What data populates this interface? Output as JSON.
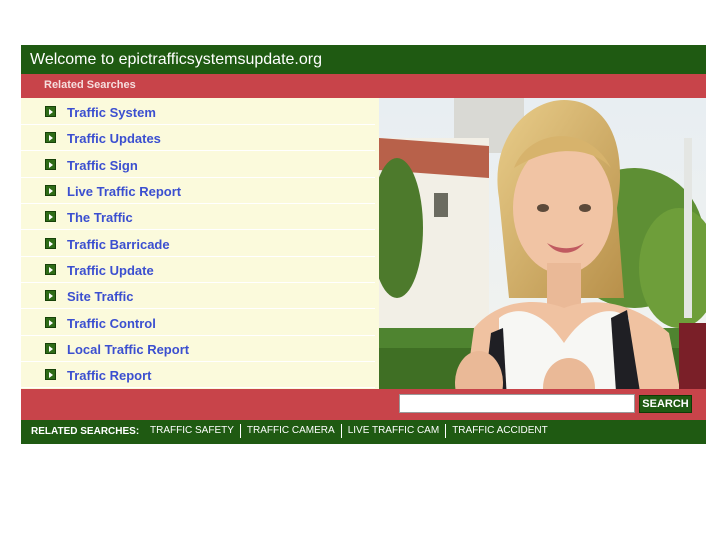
{
  "header": {
    "title": "Welcome to epictrafficsystemsupdate.org"
  },
  "related_bar": {
    "label": "Related Searches"
  },
  "list": {
    "items": [
      "Traffic System",
      "Traffic Updates",
      "Traffic Sign",
      "Live Traffic Report",
      "The Traffic",
      "Traffic Barricade",
      "Traffic Update",
      "Site Traffic",
      "Traffic Control",
      "Local Traffic Report",
      "Traffic Report"
    ]
  },
  "search": {
    "value": "",
    "button_label": "SEARCH"
  },
  "footer": {
    "lead": "RELATED SEARCHES:",
    "links": [
      "TRAFFIC SAFETY",
      "TRAFFIC CAMERA",
      "LIVE TRAFFIC CAM",
      "TRAFFIC ACCIDENT"
    ]
  },
  "colors": {
    "header_green": "#1f5a12",
    "bar_red": "#c8444a",
    "list_bg": "#fbfadc",
    "link_blue": "#3b4fd0"
  }
}
